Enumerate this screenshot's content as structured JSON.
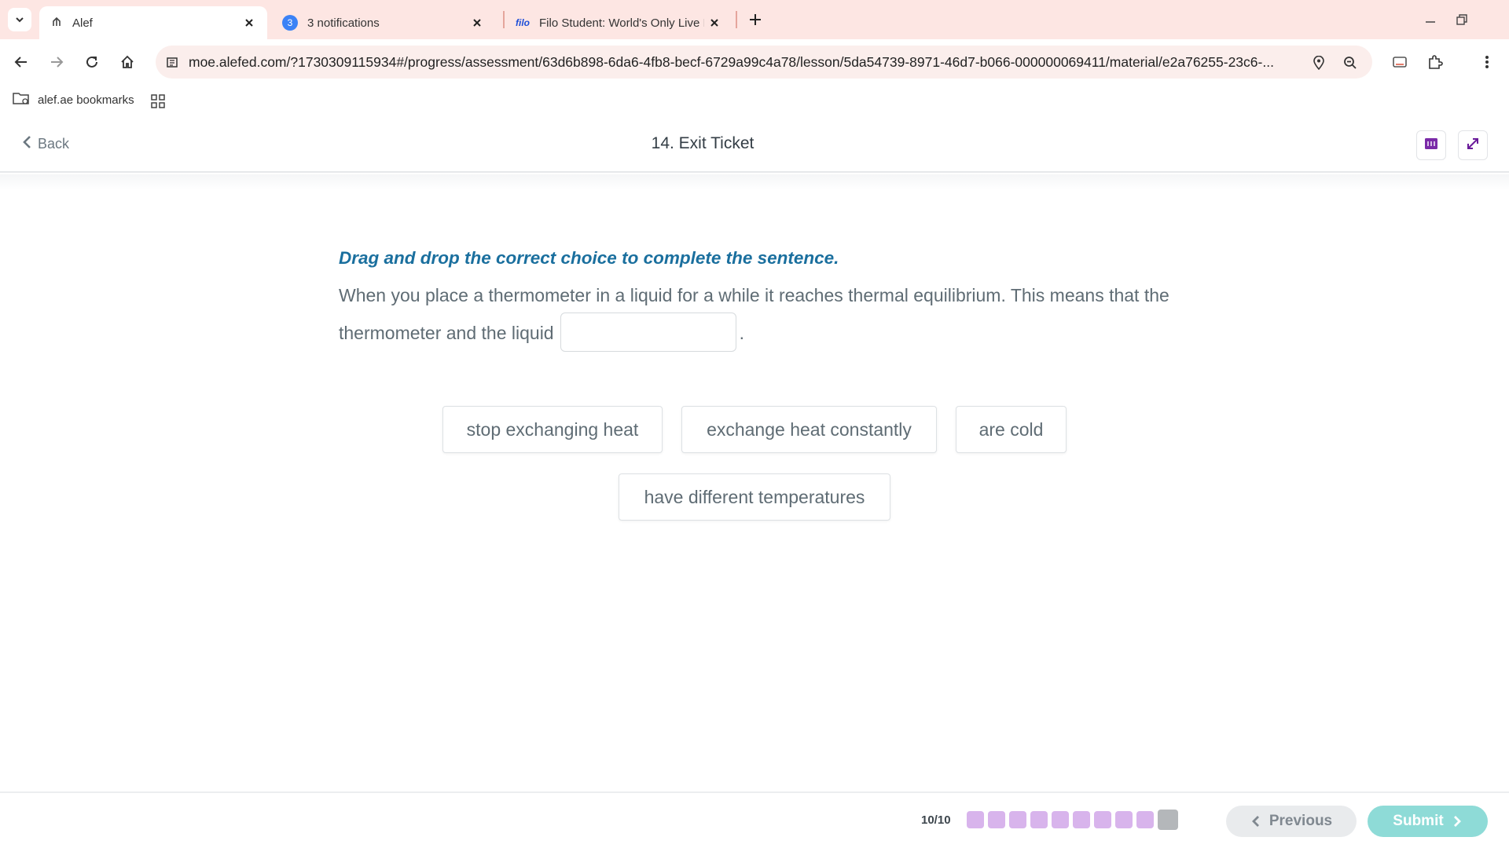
{
  "browser": {
    "tabs": [
      {
        "title": "Alef",
        "active": true
      },
      {
        "title": "3 notifications",
        "badge": "3",
        "active": false
      },
      {
        "title": "Filo Student: World's Only Live I",
        "logo": "filo",
        "active": false
      }
    ],
    "url": "moe.alefed.com/?1730309115934#/progress/assessment/63d6b898-6da6-4fb8-becf-6729a99c4a78/lesson/5da54739-8971-46d7-b066-000000069411/material/e2a76255-23c6-...",
    "bookmark": "alef.ae bookmarks"
  },
  "header": {
    "back_label": "Back",
    "title": "14. Exit Ticket"
  },
  "question": {
    "instruction": "Drag and drop the correct choice to complete the sentence.",
    "sentence_before": "When you place a thermometer in a liquid for a while it reaches thermal equilibrium. This means that the thermometer and the liquid",
    "sentence_after": ".",
    "choices": [
      "stop exchanging heat",
      "exchange heat constantly",
      "are cold",
      "have different temperatures"
    ]
  },
  "footer": {
    "progress_label": "10/10",
    "total_steps": 10,
    "current_step": 10,
    "previous_label": "Previous",
    "submit_label": "Submit"
  },
  "colors": {
    "instruction": "#1a6f9e",
    "dot_done": "#d8b4ec",
    "dot_current": "#b4b7ba",
    "submit": "#8edbd7",
    "chrome": "#fde6e3"
  },
  "icons": [
    "tab-search-icon",
    "alef-tab-icon",
    "close-icon",
    "new-tab-icon",
    "minimize-icon",
    "restore-icon",
    "back-arrow-icon",
    "forward-arrow-icon",
    "reload-icon",
    "home-icon",
    "site-info-icon",
    "location-icon",
    "zoom-icon",
    "cast-icon",
    "extensions-icon",
    "more-icon",
    "bookmark-folder-icon",
    "apps-grid-icon",
    "chevron-left-icon",
    "immersive-reader-icon",
    "expand-icon",
    "chevron-right-icon"
  ]
}
